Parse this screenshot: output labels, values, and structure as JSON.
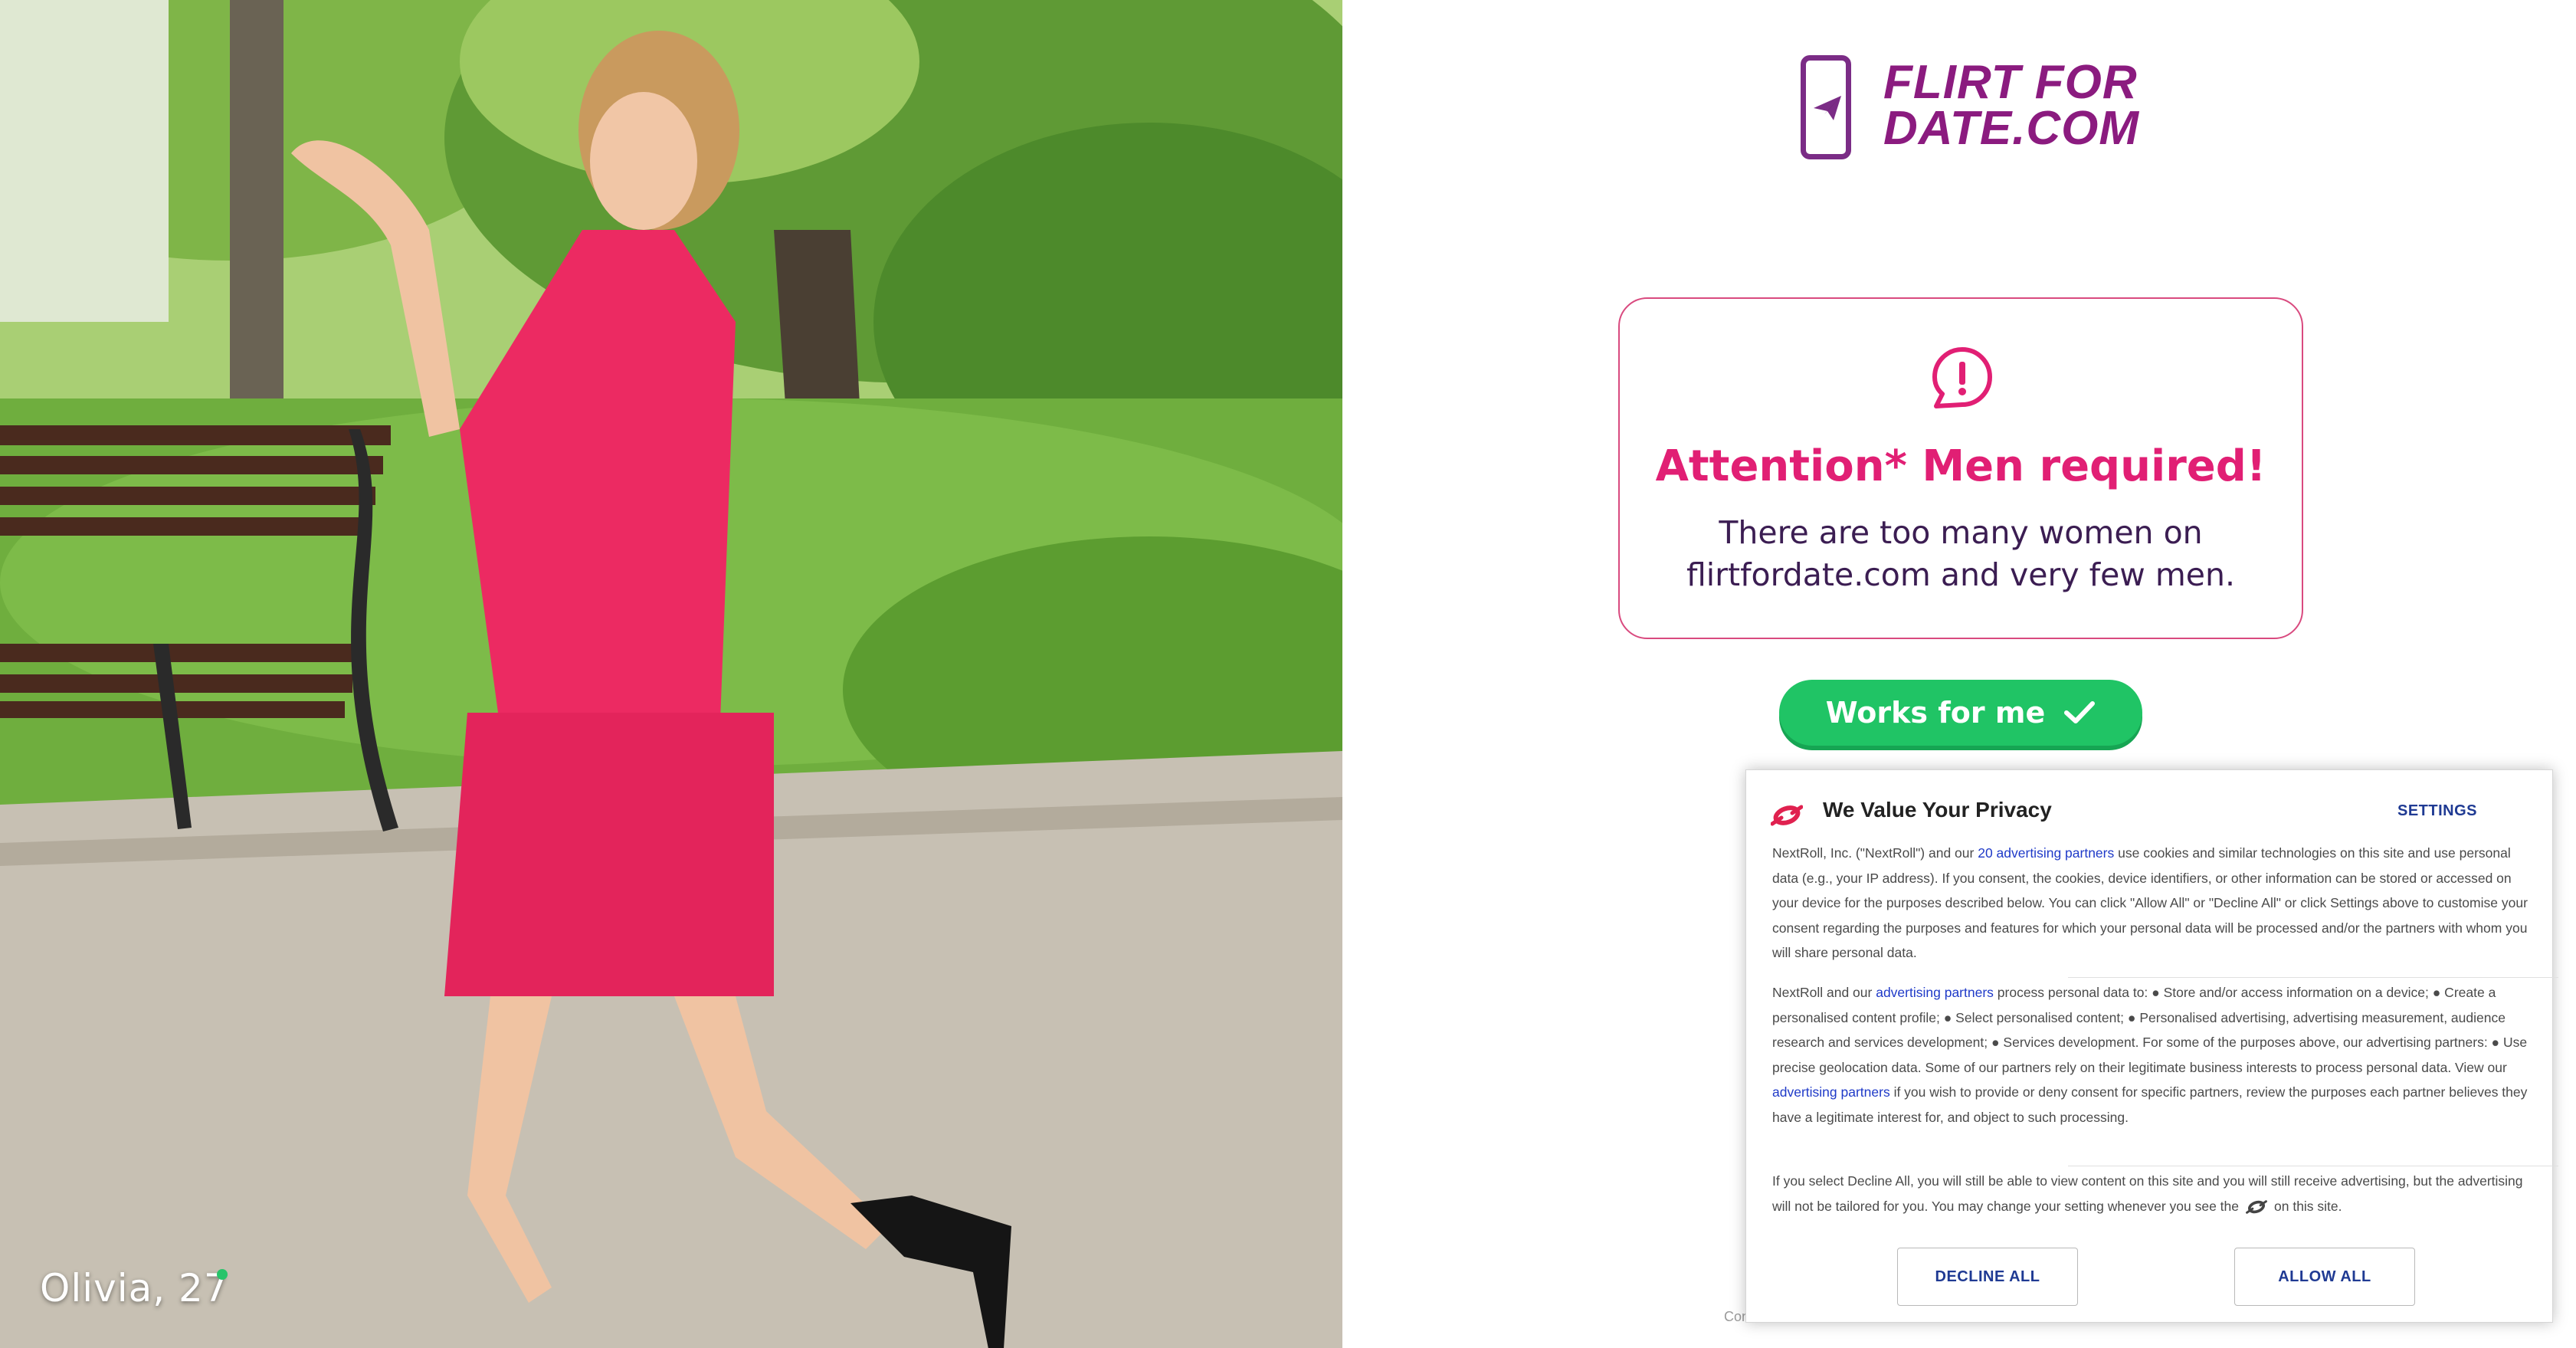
{
  "photo": {
    "caption": "Olivia, 27"
  },
  "logo": {
    "line1": "FLIRT FOR",
    "line2": "DATE.COM"
  },
  "attention": {
    "title": "Attention* Men required!",
    "body_line1": "There are too many women on",
    "body_line2": "flirtfordate.com and very few men."
  },
  "cta": {
    "label": "Works for me"
  },
  "privacy": {
    "title": "We Value Your Privacy",
    "settings": "SETTINGS",
    "p1_pre": "NextRoll, Inc. (\"NextRoll\") and our ",
    "p1_link": "20 advertising partners",
    "p1_post": " use cookies and similar technologies on this site and use personal data (e.g., your IP address). If you consent, the cookies, device identifiers, or other information can be stored or accessed on your device for the purposes described below. You can click \"Allow All\" or \"Decline All\" or click Settings above to customise your consent regarding the purposes and features for which your personal data will be processed and/or the partners with whom you will share personal data.",
    "p2_pre": "NextRoll and our ",
    "p2_link1": "advertising partners",
    "p2_mid": " process personal data to: ● Store and/or access information on a device; ● Create a personalised content profile; ● Select personalised content; ● Personalised advertising, advertising measurement, audience research and services development; ● Services development. For some of the purposes above, our advertising partners: ● Use precise geolocation data. Some of our partners rely on their legitimate business interests to process personal data. View our ",
    "p2_link2": "advertising partners",
    "p2_post": " if you wish to provide or deny consent for specific partners, review the purposes each partner believes they have a legitimate interest for, and object to such processing.",
    "p3_pre": "If you select Decline All, you will still be able to view content on this site and you will still receive advertising, but the advertising will not be tailored for you. You may change your setting whenever you see the",
    "p3_post": "on this site.",
    "decline": "DECLINE ALL",
    "allow": "ALLOW ALL"
  },
  "footer": {
    "text": "Con"
  },
  "colors": {
    "brand_purple": "#8b1b7f",
    "attention_pink": "#e11f74",
    "cta_green": "#20c465",
    "link_blue": "#1f3ac8"
  }
}
